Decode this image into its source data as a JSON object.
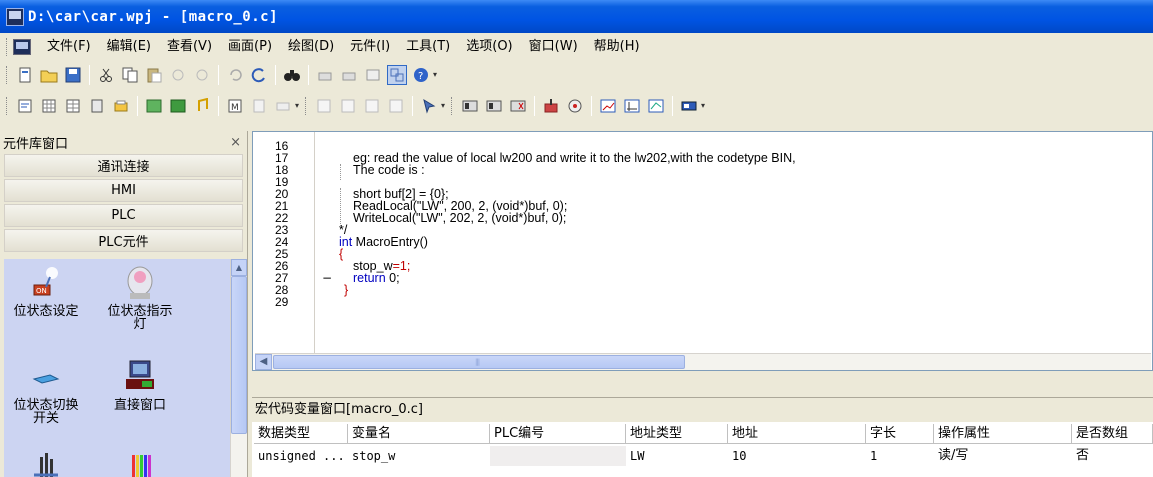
{
  "window": {
    "title": "D:\\car\\car.wpj - [macro_0.c]"
  },
  "menubar": {
    "items": [
      {
        "label": "文件(F)"
      },
      {
        "label": "编辑(E)"
      },
      {
        "label": "查看(V)"
      },
      {
        "label": "画面(P)"
      },
      {
        "label": "绘图(D)"
      },
      {
        "label": "元件(I)"
      },
      {
        "label": "工具(T)"
      },
      {
        "label": "选项(O)"
      },
      {
        "label": "窗口(W)"
      },
      {
        "label": "帮助(H)"
      }
    ]
  },
  "left_panel": {
    "title": "元件库窗口",
    "close_glyph": "×",
    "groups": [
      {
        "label": "通讯连接"
      },
      {
        "label": "HMI"
      },
      {
        "label": "PLC"
      },
      {
        "label": "PLC元件"
      }
    ],
    "items": [
      {
        "label": "位状态设定",
        "icon": "bit-set-icon"
      },
      {
        "label": "位状态指示灯",
        "icon": "bit-lamp-icon"
      },
      {
        "label": "位状态切换开关",
        "icon": "bit-toggle-icon"
      },
      {
        "label": "直接窗口",
        "icon": "direct-window-icon"
      }
    ],
    "items_text": {
      "item0": "位状态设定",
      "item1_line1": "位状态指示",
      "item1_line2": "灯",
      "item2_line1": "位状态切换",
      "item2_line2": "开关",
      "item3": "直接窗口"
    }
  },
  "editor": {
    "line_numbers": [
      "16",
      "17",
      "18",
      "19",
      "20",
      "21",
      "22",
      "23",
      "24",
      "25",
      "26",
      "27",
      "28",
      "29"
    ],
    "lines": {
      "l17": "eg: read the value of local lw200 and write it to the lw202,with the codetype BIN,",
      "l18": "The code is :",
      "l20": "short buf[2] = {0};",
      "l21": "ReadLocal(\"LW\", 200, 2, (void*)buf, 0);",
      "l22": "WriteLocal(\"LW\", 202, 2, (void*)buf, 0);",
      "l23": "*/",
      "l24_kw": "int",
      "l24_rest": " MacroEntry()",
      "l25": "{",
      "l26_a": "stop_w",
      "l26_b": "=1;",
      "l27_kw": "return",
      "l27_rest": " 0;",
      "l28": "}"
    },
    "fold_glyph": "−",
    "hscroll_grip": "|||"
  },
  "variable_window": {
    "title": "宏代码变量窗口[macro_0.c]",
    "columns": [
      "数据类型",
      "变量名",
      "PLC编号",
      "地址类型",
      "地址",
      "字长",
      "操作属性",
      "是否数组"
    ],
    "rows": [
      [
        "unsigned ...",
        "stop_w",
        "",
        "LW",
        "10",
        "1",
        "读/写",
        "否"
      ]
    ]
  },
  "colors": {
    "titlebar": "#0054e3",
    "palette_bg": "#ccd4f2",
    "keyword": "#0000c0",
    "brace": "#c00000"
  }
}
